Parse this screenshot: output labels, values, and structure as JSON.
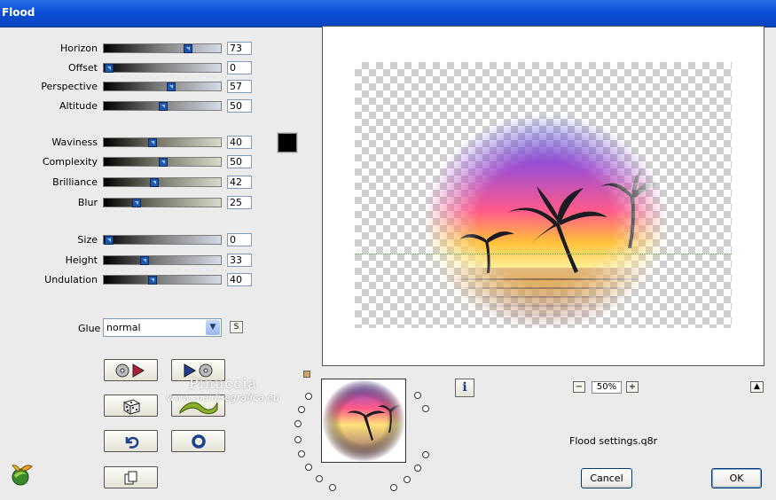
{
  "window": {
    "title": "Flood"
  },
  "groups": [
    [
      {
        "key": "horizon",
        "label": "Horizon",
        "value": "73",
        "level": 0.73,
        "track": "t1"
      },
      {
        "key": "offset",
        "label": "Offset",
        "value": "0",
        "level": 0.0,
        "track": "t1"
      },
      {
        "key": "perspective",
        "label": "Perspective",
        "value": "57",
        "level": 0.57,
        "track": "t1"
      },
      {
        "key": "altitude",
        "label": "Altitude",
        "value": "50",
        "level": 0.5,
        "track": "t1"
      }
    ],
    [
      {
        "key": "waviness",
        "label": "Waviness",
        "value": "40",
        "level": 0.4,
        "track": "t2"
      },
      {
        "key": "complexity",
        "label": "Complexity",
        "value": "50",
        "level": 0.5,
        "track": "t2"
      },
      {
        "key": "brilliance",
        "label": "Brilliance",
        "value": "42",
        "level": 0.42,
        "track": "t2"
      },
      {
        "key": "blur",
        "label": "Blur",
        "value": "25",
        "level": 0.25,
        "track": "t2"
      }
    ],
    [
      {
        "key": "size",
        "label": "Size",
        "value": "0",
        "level": 0.0,
        "track": "t1"
      },
      {
        "key": "height",
        "label": "Height",
        "value": "33",
        "level": 0.33,
        "track": "t1"
      },
      {
        "key": "undulation",
        "label": "Undulation",
        "value": "40",
        "level": 0.4,
        "track": "t1"
      }
    ]
  ],
  "color_swatch": "#000000",
  "glue": {
    "label": "Glue",
    "selected": "normal",
    "s_button": "S"
  },
  "watermark": {
    "line1": "Pinuccia",
    "line2": "www.maidiregrafica.eu"
  },
  "zoom": {
    "value": "50%",
    "minus": "−",
    "plus": "+"
  },
  "settings_file": "Flood settings.q8r",
  "buttons": {
    "cancel": "Cancel",
    "ok": "OK",
    "info": "i",
    "s": "S"
  },
  "colors": {
    "titlebar": "#0b4fd6",
    "thumb": "#1f58a8"
  }
}
